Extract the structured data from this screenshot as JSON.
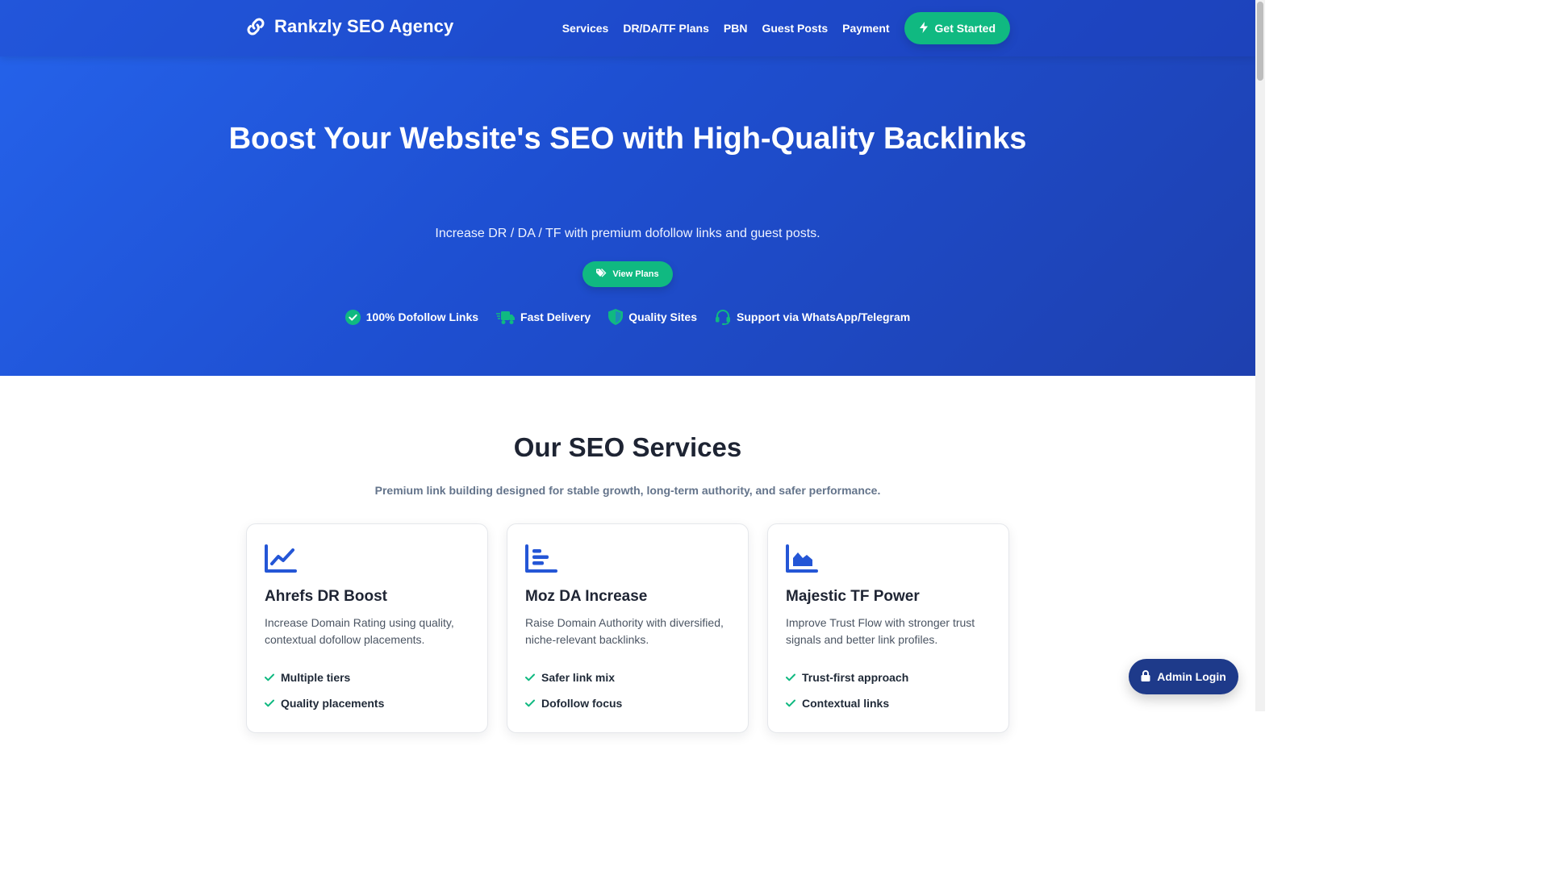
{
  "brand": {
    "name": "Rankzly SEO Agency",
    "icon": "link-icon"
  },
  "nav": {
    "links": [
      "Services",
      "DR/DA/TF Plans",
      "PBN",
      "Guest Posts",
      "Payment"
    ],
    "cta_label": "Get Started",
    "cta_icon": "bolt-icon"
  },
  "hero": {
    "title": "Boost Your Website's SEO with High-Quality Backlinks",
    "subtitle": "Increase DR / DA / TF with premium dofollow links and guest posts.",
    "button_label": "View Plans",
    "button_icon": "tags-icon",
    "features": [
      {
        "label": "100% Dofollow Links",
        "icon": "check-circle-icon"
      },
      {
        "label": "Fast Delivery",
        "icon": "truck-icon"
      },
      {
        "label": "Quality Sites",
        "icon": "shield-icon"
      },
      {
        "label": "Support via WhatsApp/Telegram",
        "icon": "headset-icon"
      }
    ]
  },
  "services": {
    "title": "Our SEO Services",
    "subtitle": "Premium link building designed for stable growth, long-term authority, and safer performance.",
    "cards": [
      {
        "title": "Ahrefs DR Boost",
        "description": "Increase Domain Rating using quality, contextual dofollow placements.",
        "icon": "line-chart-icon",
        "items": [
          "Multiple tiers",
          "Quality placements"
        ]
      },
      {
        "title": "Moz DA Increase",
        "description": "Raise Domain Authority with diversified, niche-relevant backlinks.",
        "icon": "bar-chart-icon",
        "items": [
          "Safer link mix",
          "Dofollow focus"
        ]
      },
      {
        "title": "Majestic TF Power",
        "description": "Improve Trust Flow with stronger trust signals and better link profiles.",
        "icon": "area-chart-icon",
        "items": [
          "Trust-first approach",
          "Contextual links"
        ]
      }
    ]
  },
  "admin": {
    "label": "Admin Login",
    "icon": "lock-icon"
  },
  "colors": {
    "primary": "#2563eb",
    "primary_dark": "#1e40af",
    "accent": "#10b981",
    "admin": "#1e3a8a",
    "icon_blue": "#2456d6"
  }
}
